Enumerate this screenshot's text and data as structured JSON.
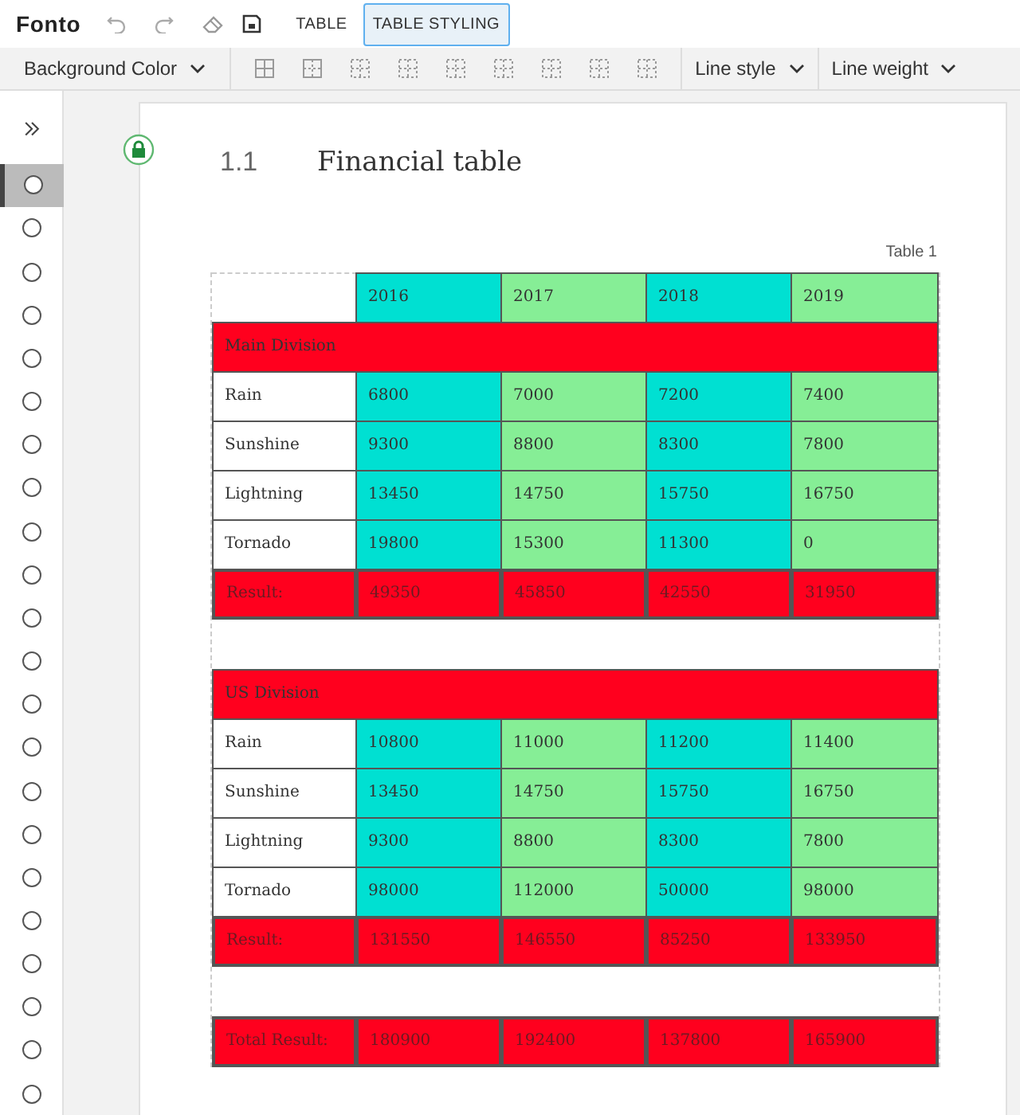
{
  "app": {
    "logo": "Fonto"
  },
  "tabs": [
    {
      "label": "TABLE",
      "selected": false
    },
    {
      "label": "TABLE STYLING",
      "selected": true
    }
  ],
  "toolbar": {
    "background_color": "Background Color",
    "line_style": "Line style",
    "line_weight": "Line weight"
  },
  "sidebar": {
    "items": [
      {
        "selected": true
      },
      {
        "selected": false
      },
      {
        "selected": false
      },
      {
        "selected": false
      },
      {
        "selected": false
      },
      {
        "selected": false
      },
      {
        "selected": false
      },
      {
        "selected": false
      },
      {
        "selected": false
      },
      {
        "selected": false
      },
      {
        "selected": false
      },
      {
        "selected": false
      },
      {
        "selected": false
      },
      {
        "selected": false
      },
      {
        "selected": false
      },
      {
        "selected": false
      },
      {
        "selected": false
      },
      {
        "selected": false
      },
      {
        "selected": false
      },
      {
        "selected": false
      },
      {
        "selected": false
      },
      {
        "selected": false
      }
    ]
  },
  "document": {
    "number": "1.1",
    "title": "Financial table",
    "table_caption": "Table 1"
  },
  "table": {
    "columns": [
      {
        "color": "#ffffff"
      },
      {
        "color": "#00e0d2"
      },
      {
        "color": "#86ee96"
      },
      {
        "color": "#00e0d2"
      },
      {
        "color": "#86ee96"
      }
    ],
    "rows": [
      {
        "kind": "header",
        "cells": [
          "",
          "2016",
          "2017",
          "2018",
          "2019"
        ]
      },
      {
        "kind": "section",
        "color": "#ff001e",
        "cells": [
          "Main Division"
        ]
      },
      {
        "kind": "data",
        "cells": [
          "Rain",
          "6800",
          "7000",
          "7200",
          "7400"
        ]
      },
      {
        "kind": "data",
        "cells": [
          "Sunshine",
          "9300",
          "8800",
          "8300",
          "7800"
        ]
      },
      {
        "kind": "data",
        "cells": [
          "Lightning",
          "13450",
          "14750",
          "15750",
          "16750"
        ]
      },
      {
        "kind": "data",
        "cells": [
          "Tornado",
          "19800",
          "15300",
          "11300",
          "0"
        ]
      },
      {
        "kind": "result",
        "color": "#ff001e",
        "cells": [
          "Result:",
          "49350",
          "45850",
          "42550",
          "31950"
        ]
      },
      {
        "kind": "spacer"
      },
      {
        "kind": "section",
        "color": "#ff001e",
        "cells": [
          "US Division"
        ]
      },
      {
        "kind": "data",
        "cells": [
          "Rain",
          "10800",
          "11000",
          "11200",
          "11400"
        ]
      },
      {
        "kind": "data",
        "cells": [
          "Sunshine",
          "13450",
          "14750",
          "15750",
          "16750"
        ]
      },
      {
        "kind": "data",
        "cells": [
          "Lightning",
          "9300",
          "8800",
          "8300",
          "7800"
        ]
      },
      {
        "kind": "data",
        "cells": [
          "Tornado",
          "98000",
          "112000",
          "50000",
          "98000"
        ]
      },
      {
        "kind": "result",
        "color": "#ff001e",
        "cells": [
          "Result:",
          "131550",
          "146550",
          "85250",
          "133950"
        ]
      },
      {
        "kind": "spacer"
      },
      {
        "kind": "result",
        "color": "#ff001e",
        "cells": [
          "Total Result:",
          "180900",
          "192400",
          "137800",
          "165900"
        ]
      }
    ]
  }
}
